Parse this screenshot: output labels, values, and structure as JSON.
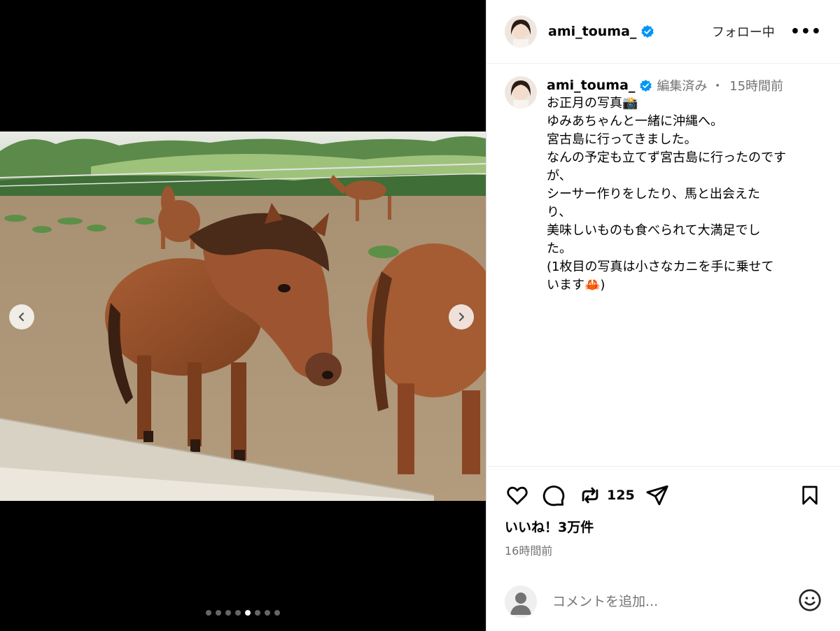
{
  "post": {
    "username": "ami_touma_",
    "follow_label": "フォロー中",
    "more_label": "•••"
  },
  "caption": {
    "username": "ami_touma_",
    "edited": "編集済み ・",
    "time": "15時間前",
    "lines": [
      "お正月の写真📸",
      "ゆみあちゃんと一緒に沖縄へ。",
      "宮古島に行ってきました。",
      "なんの予定も立てず宮古島に行ったのです",
      "が、",
      "シーサー作りをしたり、馬と出会えた",
      "り、",
      "美味しいものも食べられて大満足でし",
      "た。",
      "(1枚目の写真は小さなカニを手に乗せて",
      "います🦀)"
    ]
  },
  "actions": {
    "repost_count": "125",
    "likes": "いいね！3万件",
    "posted_time": "16時間前"
  },
  "comment": {
    "placeholder": "コメントを追加..."
  },
  "carousel": {
    "total": 8,
    "active_index": 4
  },
  "icons": {
    "prev": "chevron-left-icon",
    "next": "chevron-right-icon",
    "like": "heart-icon",
    "comment": "comment-icon",
    "repost": "repost-icon",
    "share": "send-icon",
    "save": "bookmark-icon",
    "verified": "verified-badge-icon",
    "emoji": "emoji-icon"
  },
  "colors": {
    "verified": "#0095f6",
    "secondary_text": "#737373"
  }
}
